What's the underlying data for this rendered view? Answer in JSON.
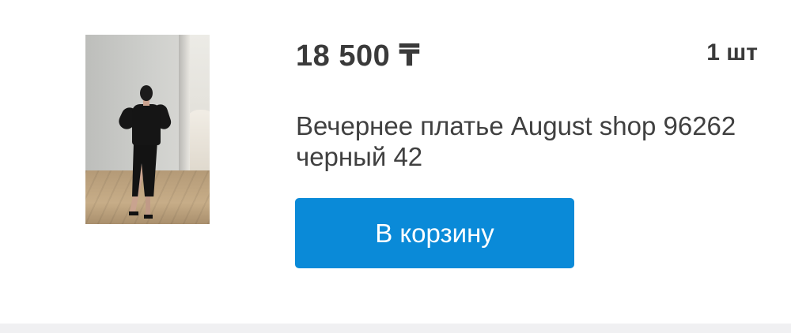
{
  "product": {
    "price": "18 500 ₸",
    "quantity": "1 шт",
    "title": "Вечернее платье August shop 96262 черный 42",
    "image_alt": "product-photo-black-evening-dress"
  },
  "actions": {
    "add_to_cart_label": "В корзину"
  },
  "colors": {
    "button_bg": "#0a8ad8",
    "text": "#3a3a3a",
    "divider": "#f0f0f2"
  }
}
